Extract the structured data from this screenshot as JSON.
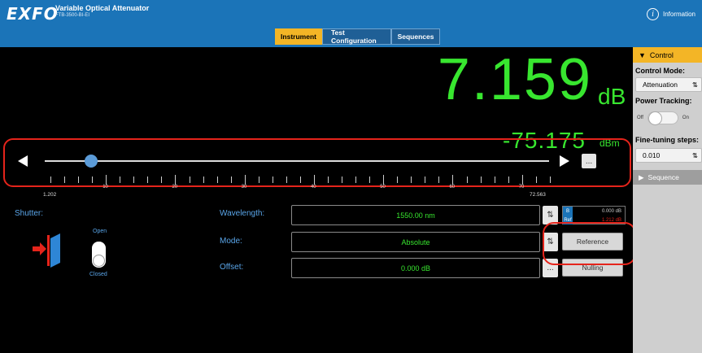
{
  "header": {
    "logo": "EXFO",
    "title": "Variable Optical Attenuator",
    "model": "FTB-3500-BI-EI",
    "info_label": "Information",
    "tabs": [
      {
        "label": "Instrument",
        "active": true
      },
      {
        "label": "Test Configuration",
        "active": false
      },
      {
        "label": "Sequences",
        "active": false
      }
    ]
  },
  "readout": {
    "attenuation": "7.159",
    "attenuation_unit": "dB",
    "power": "-75.175",
    "power_unit": "dBm"
  },
  "slider": {
    "min_label": "1.202",
    "max_label": "72.563",
    "tick_labels": [
      "10",
      "20",
      "30",
      "40",
      "50",
      "60",
      "70"
    ],
    "more_label": "..."
  },
  "shutter": {
    "label": "Shutter:",
    "open_label": "Open",
    "closed_label": "Closed"
  },
  "fields": {
    "wavelength_label": "Wavelength:",
    "wavelength_value": "1550.00 nm",
    "mode_label": "Mode:",
    "mode_value": "Absolute",
    "offset_label": "Offset:",
    "offset_value": "0.000 dB",
    "offset_more": "..."
  },
  "reference_box": {
    "rows": [
      {
        "key": "B",
        "value": "0.000 dB"
      },
      {
        "key": "Ref",
        "value": "1.212 dB"
      }
    ]
  },
  "buttons": {
    "reference": "Reference",
    "nulling": "Nulling"
  },
  "panel": {
    "control_header": "Control",
    "control_mode_label": "Control Mode:",
    "control_mode_value": "Attenuation",
    "power_tracking_label": "Power Tracking:",
    "toggle_off": "Off",
    "toggle_on": "On",
    "fine_tuning_label": "Fine-tuning steps:",
    "fine_tuning_value": "0.010",
    "sequence_header": "Sequence"
  },
  "colors": {
    "accent": "#f3b526",
    "header_blue": "#1b74b8",
    "readout_green": "#38e62f",
    "label_blue": "#5aa6ea",
    "highlight_red": "#e5241b"
  }
}
